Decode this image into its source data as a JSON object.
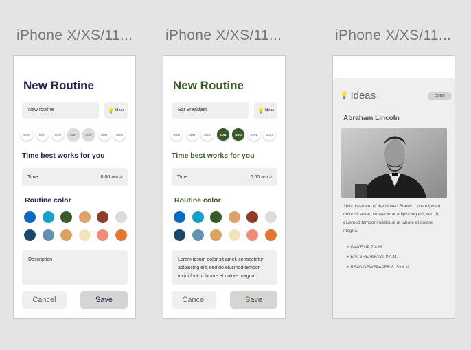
{
  "frames": [
    {
      "title": "iPhone X/XS/11...",
      "heading": "New Routine",
      "name_value": "New routine",
      "ideas_label": "Ideas",
      "days": [
        "SUN",
        "SUN",
        "SUN",
        "SUN",
        "SUN",
        "SUN",
        "SUN"
      ],
      "selected_day_indices": [
        3,
        4
      ],
      "section_time": "Time best works for you",
      "time_label": "Time",
      "time_value": "0:00 am >",
      "section_color": "Routine color",
      "description": "Description",
      "cancel_label": "Cancel",
      "save_label": "Save"
    },
    {
      "title": "iPhone X/XS/11...",
      "heading": "New Routine",
      "name_value": "Eat Breakfast",
      "ideas_label": "Ideas",
      "days": [
        "SUN",
        "SUN",
        "SUN",
        "SUN",
        "SUN",
        "SUN",
        "SUN"
      ],
      "selected_day_indices": [
        3,
        4
      ],
      "section_time": "Time best works for you",
      "time_label": "Time",
      "time_value": "0:00 am >",
      "section_color": "Routine color",
      "description": "Lorem ipsum dolor sit amet, consectetur adipiscing elit, sed do eiusmod tempor incididunt ut labore et dolore magna.",
      "cancel_label": "Cancel",
      "save_label": "Save"
    },
    {
      "title": "iPhone X/XS/11...",
      "heading": "Ideas",
      "done_label": "DONE",
      "person_name": "Abraham Lincoln",
      "bio": "16th president of the United States. Lorem ipsum dolor sit amet, consectetur adipiscing elit, sed do eiusmod tempor incididunt ut labore et dolore magna.",
      "steps": [
        "+ WAKE UP 7 A.M.",
        "+ EAT BREAKFAST 8 A.M.",
        "+ READ NEWSPAPER 8 :30 A.M."
      ]
    }
  ],
  "colors": {
    "row1": [
      "#0b6ac4",
      "#1aa0c8",
      "#3b5a2c",
      "#dca36e",
      "#8e3d2b",
      "#dcdcdc"
    ],
    "row2": [
      "#1c4866",
      "#6490b2",
      "#dda05e",
      "#f2e5bd",
      "#ef8b76",
      "#e07631"
    ],
    "navy_heading": "#25264f",
    "green_heading": "#3b5a2c"
  },
  "icons": [
    "lightbulb-icon"
  ]
}
